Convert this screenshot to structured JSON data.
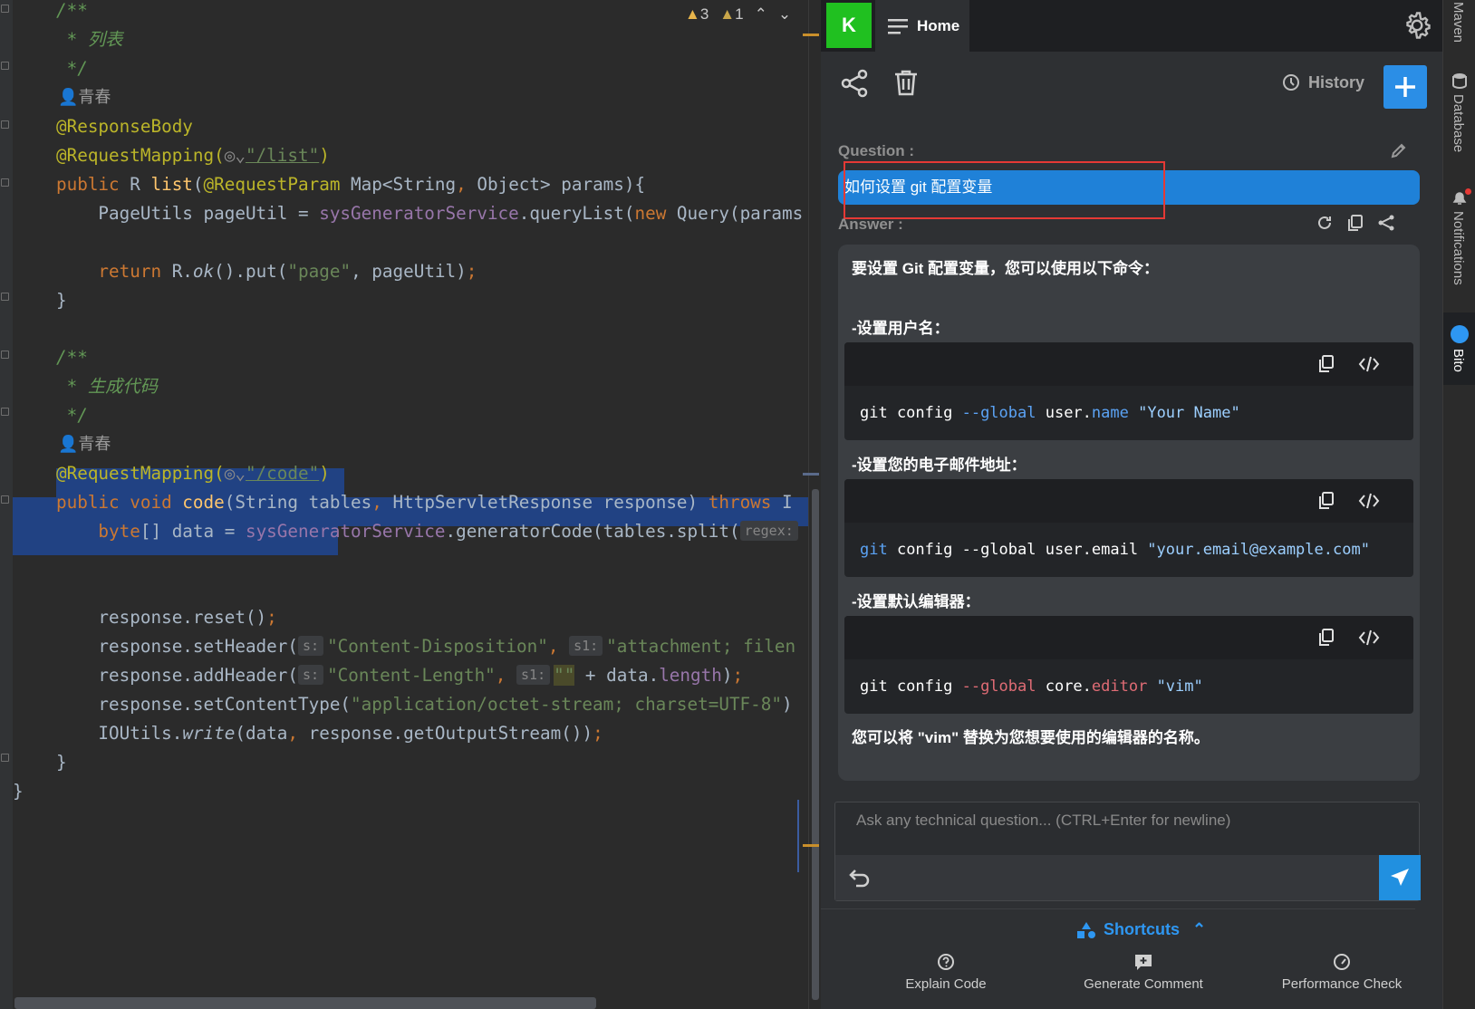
{
  "editor": {
    "markers": {
      "warnings": "3",
      "weak_warnings": "1"
    },
    "author": "青春",
    "lines": {
      "c1_open": "/**",
      "c1_body": " * 列表",
      "c1_close": " */",
      "ann_response_body": "@ResponseBody",
      "ann_request_mapping": "@RequestMapping(",
      "list_path": "\"/list\"",
      "list_sig_a": "public",
      "list_sig_b": " R ",
      "list_sig_fn": "list",
      "list_sig_c": "(",
      "list_sig_ann": "@RequestParam",
      "list_sig_d": " Map<String",
      "list_sig_e": ", ",
      "list_sig_f": "Object> params){",
      "query_a": "    PageUtils pageUtil = ",
      "query_svc": "sysGeneratorService",
      "query_b": ".queryList(",
      "query_new": "new",
      "query_c": " Query(params",
      "ret_kw": "    return",
      "ret_a": " R.",
      "ret_ok": "ok",
      "ret_b": "().put(",
      "ret_str": "\"page\"",
      "ret_c": ", pageUtil)",
      "ret_semi": ";",
      "brace_close": "}",
      "c2_open": "/**",
      "c2_body": " * 生成代码",
      "c2_close": " */",
      "code_path": "\"/code\"",
      "code_paren": ")",
      "code_sig_a": "public void",
      "code_sig_fn": " code",
      "code_sig_b": "(String tables",
      "code_sig_c": ", ",
      "code_sig_d": "HttpServletResponse response) ",
      "code_sig_throws": "throws",
      "code_sig_e": " I",
      "byte_kw": "    byte",
      "byte_a": "[] data = ",
      "byte_svc": "sysGeneratorService",
      "byte_b": ".generatorCode(tables.split(",
      "byte_hint": "regex:",
      "reset": "    response.reset()",
      "set_header": "    response.setHeader(",
      "hint_s": "s:",
      "cd_str": "\"Content-Disposition\"",
      "hint_s1": "s1:",
      "attach_str": "\"attachment; filen",
      "add_header": "    response.addHeader(",
      "cl_str": "\"Content-Length\"",
      "empty_str": "\"\"",
      "add_header_tail": " + data.",
      "length_fld": "length",
      "ct_a": "    response.setContentType(",
      "ct_str": "\"application/octet-stream; charset=UTF-8\"",
      "ct_b": ")",
      "io_a": "    IOUtils.",
      "io_write": "write",
      "io_b": "(data",
      "io_c": ", ",
      "io_d": "response.getOutputStream())",
      "inner_close": "}",
      "class_close": "}"
    }
  },
  "panel": {
    "avatar_letter": "K",
    "home_tab": "Home",
    "history_label": "History",
    "question_label": "Question :",
    "question_text": "如何设置 git 配置变量",
    "answer_label": "Answer :",
    "answer": {
      "intro": "要设置 Git 配置变量，您可以使用以下命令：",
      "step1": "-设置用户名：",
      "code1": {
        "a": "git config ",
        "b": "--global",
        "c": " user.",
        "d": "name",
        "e": " \"Your Name\""
      },
      "step2": "-设置您的电子邮件地址：",
      "code2": {
        "a": "git",
        "b": " config --global user.email ",
        "c": "\"your.email@example.com\""
      },
      "step3": "-设置默认编辑器：",
      "code3": {
        "a": "git config ",
        "b": "--global",
        "c": " core.",
        "d": "editor",
        "e": " \"vim\""
      },
      "outro": "您可以将 \"vim\" 替换为您想要使用的编辑器的名称。"
    },
    "input_placeholder": "Ask any technical question... (CTRL+Enter for newline)",
    "shortcuts_label": "Shortcuts",
    "shortcut_items": [
      "Explain Code",
      "Generate Comment",
      "Performance Check"
    ]
  },
  "right_sidebar": [
    "Maven",
    "Database",
    "Notifications",
    "Bito"
  ],
  "colors": {
    "accent": "#2b8ee6",
    "question_bg": "#1f81d8",
    "avatar": "#20c020",
    "selection": "#214283"
  }
}
